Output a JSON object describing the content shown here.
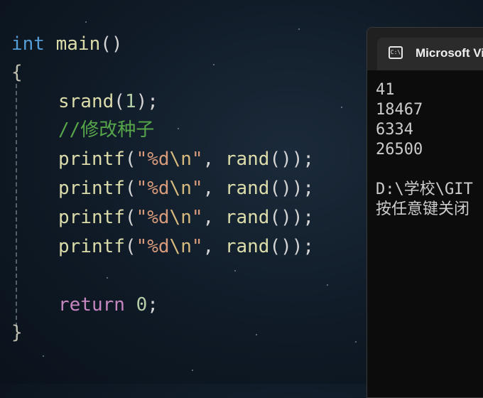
{
  "editor": {
    "kw_int": "int",
    "fn_main": "main",
    "parens": "()",
    "brace_open": "{",
    "brace_close": "}",
    "srand_call": "srand",
    "srand_open": "(",
    "srand_arg": "1",
    "srand_close": ");",
    "comment": "//修改种子",
    "printf_lines": [
      {
        "fn": "printf",
        "open": "(",
        "str_a": "\"%d",
        "esc": "\\n",
        "str_b": "\"",
        "comma": ", ",
        "rand": "rand",
        "tail": "());"
      },
      {
        "fn": "printf",
        "open": "(",
        "str_a": "\"%d",
        "esc": "\\n",
        "str_b": "\"",
        "comma": ", ",
        "rand": "rand",
        "tail": "());"
      },
      {
        "fn": "printf",
        "open": "(",
        "str_a": "\"%d",
        "esc": "\\n",
        "str_b": "\"",
        "comma": ", ",
        "rand": "rand",
        "tail": "());"
      },
      {
        "fn": "printf",
        "open": "(",
        "str_a": "\"%d",
        "esc": "\\n",
        "str_b": "\"",
        "comma": ", ",
        "rand": "rand",
        "tail": "());"
      }
    ],
    "return_kw": "return",
    "return_val": "0",
    "semicolon": ";"
  },
  "console": {
    "tab_title": "Microsoft Vi",
    "icon_text": "C:\\",
    "output": [
      "41",
      "18467",
      "6334",
      "26500",
      "",
      "D:\\学校\\GIT",
      "按任意键关闭"
    ]
  },
  "colors": {
    "keyword_type": "#569cd6",
    "function": "#dcdcaa",
    "string": "#d79a7a",
    "comment": "#57a64a",
    "control_keyword": "#c586c0",
    "number": "#b5cea8"
  }
}
